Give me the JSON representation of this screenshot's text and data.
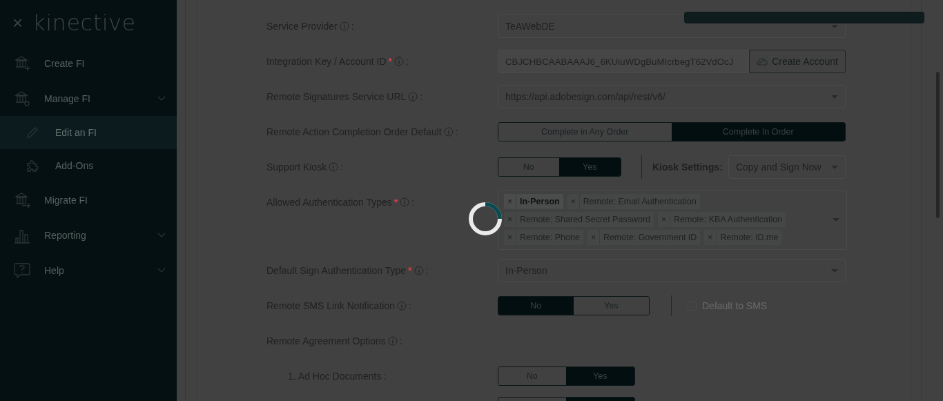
{
  "sidebar": {
    "close": "×",
    "logo": "kinective",
    "items": [
      {
        "label": "Create FI",
        "selected": false,
        "has_submenu": false
      },
      {
        "label": "Manage FI",
        "selected": false,
        "has_submenu": true,
        "children": [
          {
            "label": "Edit an FI",
            "selected": true
          },
          {
            "label": "Add-Ons",
            "selected": false
          }
        ]
      },
      {
        "label": "Migrate FI",
        "selected": false,
        "has_submenu": false
      },
      {
        "label": "Reporting",
        "selected": false,
        "has_submenu": true
      },
      {
        "label": "Help",
        "selected": false,
        "has_submenu": true
      }
    ]
  },
  "form": {
    "rows": [
      {
        "kind": "select",
        "label": "Service Provider",
        "info": true,
        "separator": ":",
        "value": "TeAWebDE"
      },
      {
        "kind": "key",
        "label": "Integration Key / Account ID",
        "required": "*",
        "info": true,
        "separator": ":",
        "value": "CBJCHBCAABAAAJ6_6KUiuWDgBuMIcrbegT62VdOcJ",
        "button": "Create Account"
      },
      {
        "kind": "select",
        "label": "Remote Signatures Service URL",
        "info": true,
        "separator": ":",
        "value": "https://api.adobesign.com/api/rest/v6/"
      },
      {
        "kind": "toggle",
        "label": "Remote Action Completion Order Default",
        "info": true,
        "separator": ":",
        "wide": true,
        "options": [
          {
            "label": "Complete in Any Order",
            "selected": false
          },
          {
            "label": "Complete In Order",
            "selected": true
          }
        ]
      },
      {
        "kind": "toggle",
        "label": "Support Kiosk",
        "info": true,
        "separator": ":",
        "options": [
          {
            "label": "No",
            "selected": false
          },
          {
            "label": "Yes",
            "selected": true
          }
        ],
        "extra": {
          "kind": "select",
          "label": "Kiosk Settings:",
          "value": "Copy and Sign Now"
        }
      },
      {
        "kind": "multiselect",
        "label": "Allowed Authentication Types",
        "required": "*",
        "info": true,
        "separator": ":",
        "remove": "×",
        "tags": [
          {
            "label": "In-Person",
            "selected": true
          },
          {
            "label": "Remote: Email Authentication",
            "selected": false
          },
          {
            "label": "Remote: Shared Secret Password",
            "selected": false
          },
          {
            "label": "Remote: KBA Authentication",
            "selected": false
          },
          {
            "label": "Remote: Phone",
            "selected": false
          },
          {
            "label": "Remote: Government ID",
            "selected": false
          },
          {
            "label": "Remote: ID.me",
            "selected": false
          }
        ]
      },
      {
        "kind": "select",
        "label": "Default Sign Authentication Type",
        "required": "*",
        "info": true,
        "separator": ":",
        "value": "In-Person"
      },
      {
        "kind": "toggle",
        "label": "Remote SMS Link Notification",
        "info": true,
        "separator": ":",
        "options": [
          {
            "label": "No",
            "selected": true
          },
          {
            "label": "Yes",
            "selected": false
          }
        ],
        "extra": {
          "kind": "checkbox",
          "label": "Default to SMS",
          "checked": false,
          "disabled": true
        }
      },
      {
        "kind": "heading",
        "label": "Remote Agreement Options",
        "info": true,
        "separator": ":"
      },
      {
        "kind": "toggle",
        "label": "1. Ad Hoc Documents",
        "info": false,
        "separator": ":",
        "sub": true,
        "options": [
          {
            "label": "No",
            "selected": false
          },
          {
            "label": "Yes",
            "selected": true
          }
        ]
      },
      {
        "kind": "toggle_partial",
        "options": [
          {
            "selected": false
          },
          {
            "selected": true
          }
        ]
      }
    ]
  },
  "loading": true,
  "notification": true
}
